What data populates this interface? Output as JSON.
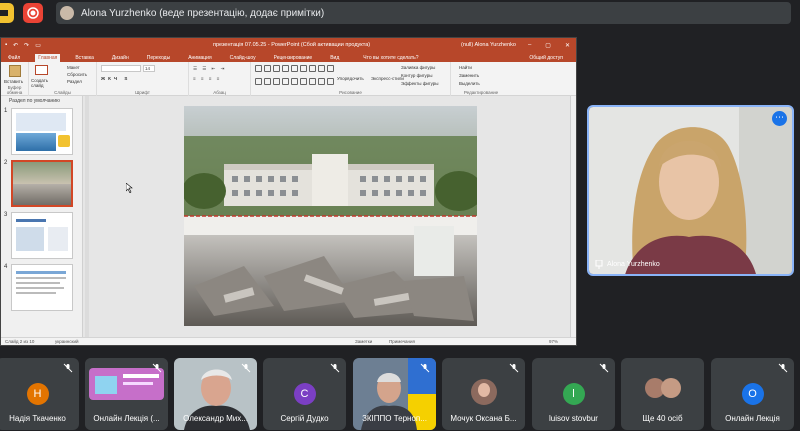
{
  "presenter": {
    "text": "Alona Yurzhenko (веде презентацію, додає примітки)"
  },
  "ppt": {
    "title": "презентація 07.05.25 - PowerPoint (Сбой активации продукта)",
    "user": "(null) Alona Yurzhenko",
    "tabs": [
      "Файл",
      "Главная",
      "Вставка",
      "Дизайн",
      "Переходы",
      "Анимация",
      "Слайд-шоу",
      "Рецензирование",
      "Вид"
    ],
    "tell_me": "Что вы хотите сделать?",
    "share": "Общий доступ",
    "ribbon": {
      "clipboard": "Буфер обмена",
      "paste": "Вставить",
      "slides": "Слайды",
      "new_slide": "Создать слайд",
      "layout": "Макет",
      "reset": "Сбросить",
      "section": "Раздел",
      "font": "Шрифт",
      "font_size": "14",
      "paragraph": "Абзац",
      "drawing": "Рисование",
      "arrange": "Упорядочить",
      "quick_styles": "Экспресс-стили",
      "shape_fill": "Заливка фигуры",
      "shape_outline": "Контур фигуры",
      "shape_effects": "Эффекты фигуры",
      "find": "Найти",
      "replace": "Заменить",
      "select": "Выделить",
      "editing": "Редактирование"
    },
    "section_label": "Раздел по умолчанию",
    "slide_numbers": [
      "1",
      "2",
      "3",
      "4"
    ],
    "status": {
      "slide": "Слайд 2 из 10",
      "lang": "украинский",
      "notes": "Заметки",
      "comments": "Примечания",
      "zoom": "97%"
    }
  },
  "speaker": {
    "name": "Alona Yurzhenko",
    "more_icon": "more-vert-icon"
  },
  "participants": [
    {
      "name": "Надія Ткаченко",
      "initial": "Н",
      "color": "#e37400"
    },
    {
      "name": "Онлайн Лекція (...",
      "initial": "",
      "color": ""
    },
    {
      "name": "Олександр Мих...",
      "initial": "",
      "color": ""
    },
    {
      "name": "Сергій Дудко",
      "initial": "С",
      "color": "#7b3fc4"
    },
    {
      "name": "ЗКІППО Терноп...",
      "initial": "",
      "color": ""
    },
    {
      "name": "Мочук Оксана Б...",
      "initial": "",
      "color": ""
    },
    {
      "name": "luisov stovbur",
      "initial": "l",
      "color": "#34a853"
    },
    {
      "name": "Ще 40 осіб",
      "initial": "",
      "color": ""
    },
    {
      "name": "Онлайн Лекція",
      "initial": "О",
      "color": "#1a73e8"
    }
  ]
}
